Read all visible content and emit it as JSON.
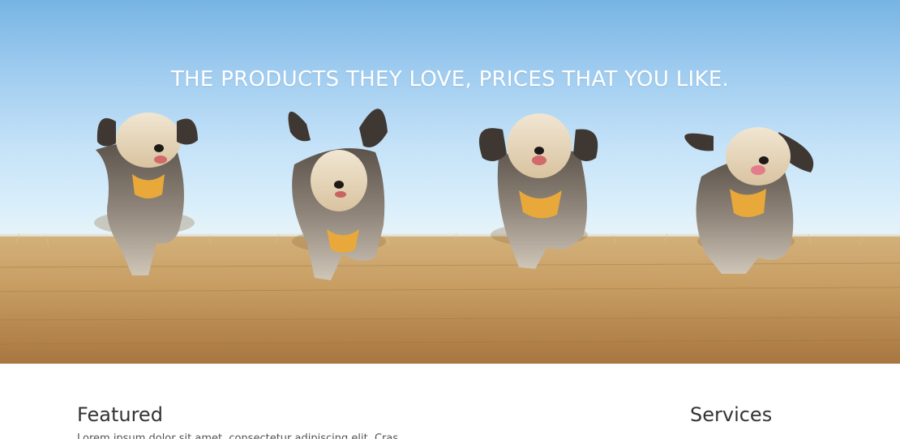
{
  "hero": {
    "title": "THE PRODUCTS THEY LOVE, PRICES THAT YOU LIKE.",
    "image_subject": "four small dogs running through a dry golden grass field under a blue sky",
    "colors": {
      "sky_top": "#77b4e3",
      "sky_horizon": "#dbeffb",
      "field": "#c9a26a",
      "harness": "#e9a93a"
    }
  },
  "sections": {
    "featured": {
      "heading": "Featured",
      "text": "Lorem ipsum dolor sit amet, consectetur adipiscing elit. Cras..."
    },
    "services": {
      "heading": "Services"
    }
  }
}
